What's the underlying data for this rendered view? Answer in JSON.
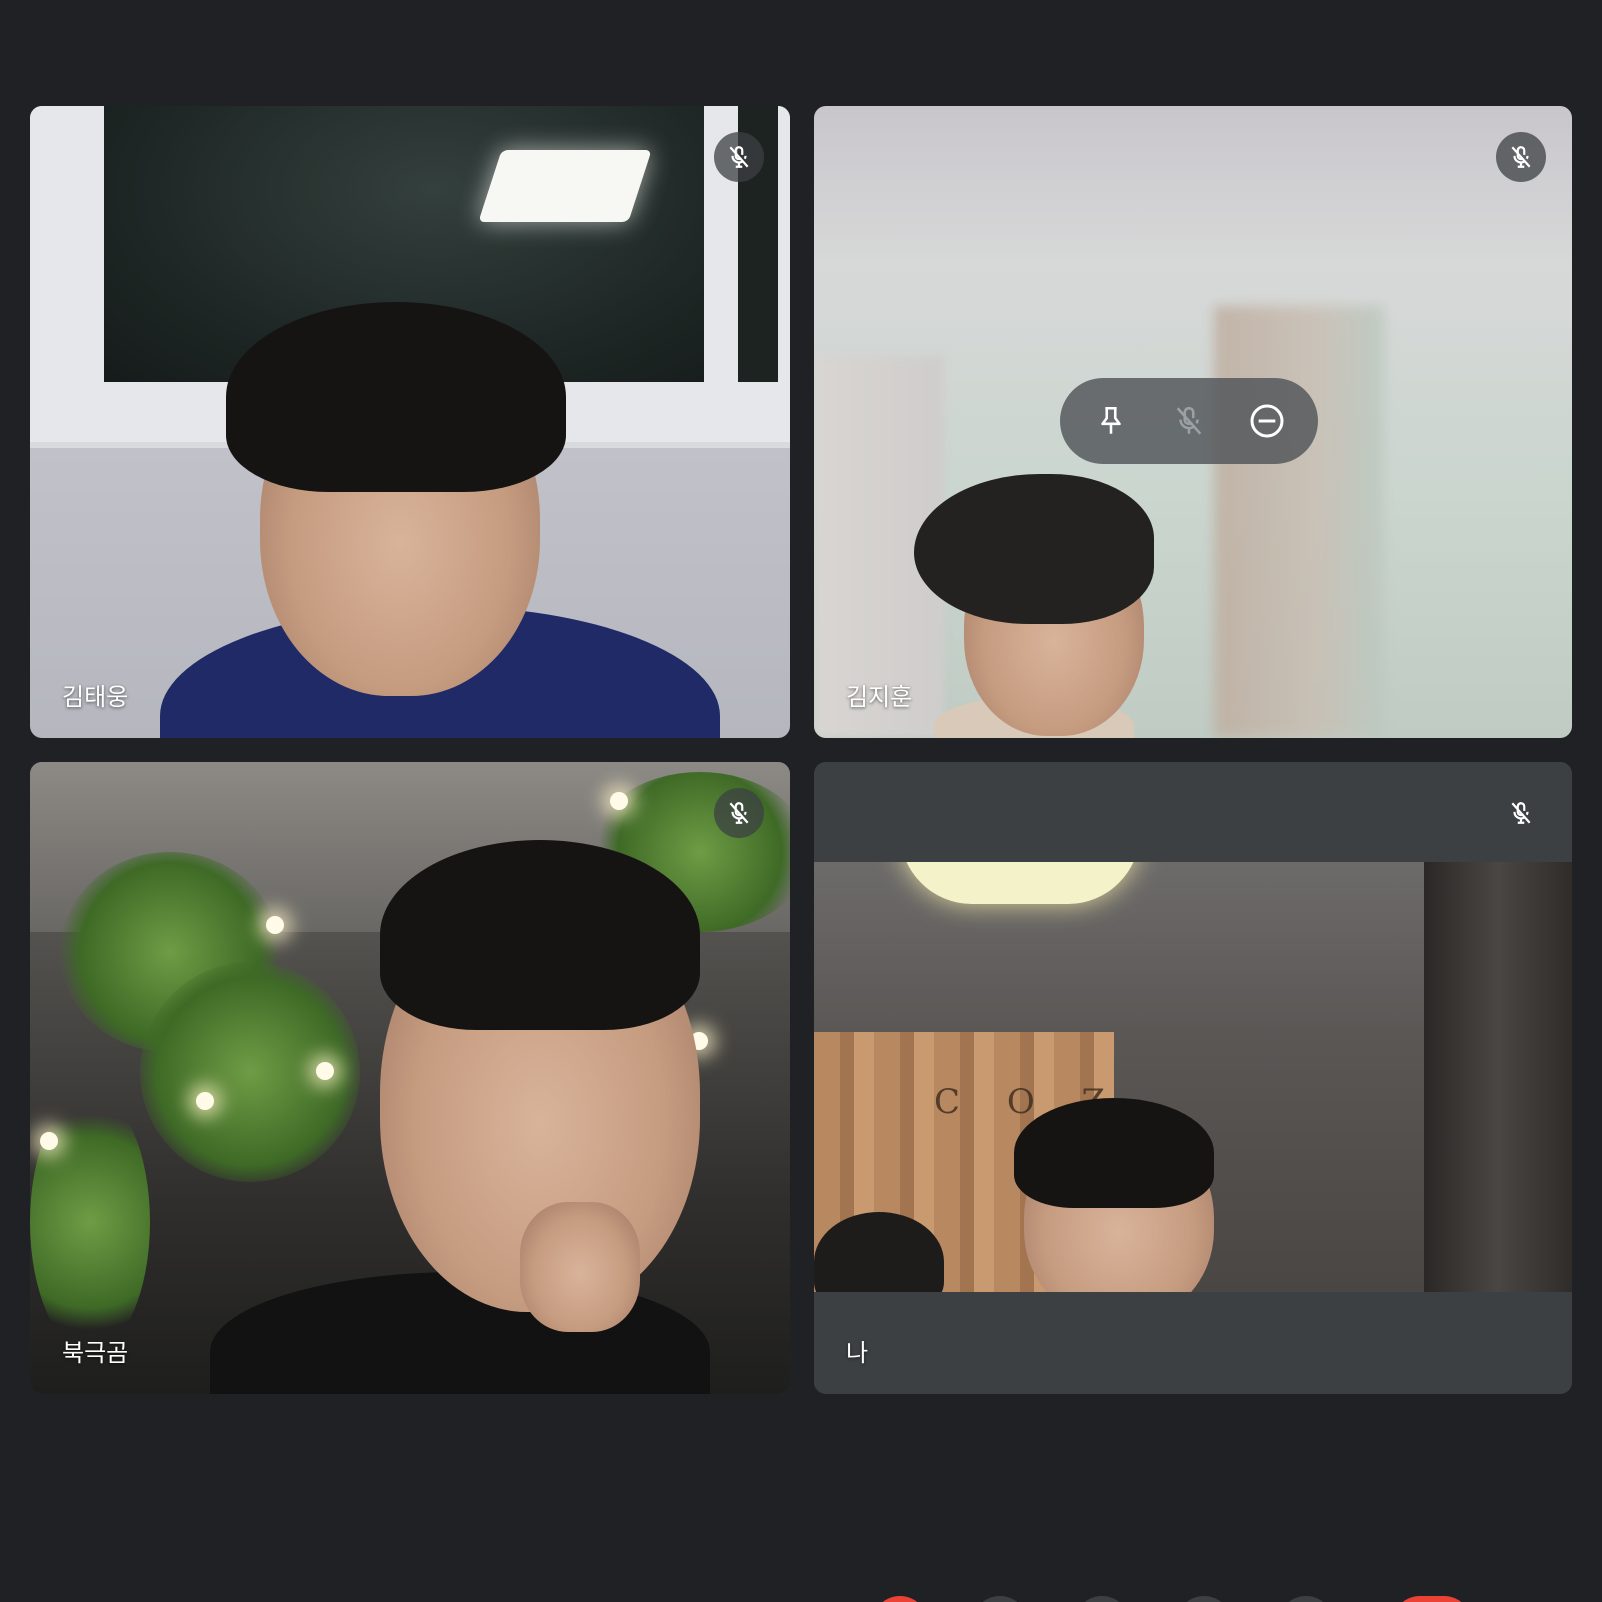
{
  "participants": [
    {
      "name": "김태웅",
      "muted": true
    },
    {
      "name": "김지훈",
      "muted": true
    },
    {
      "name": "북극곰",
      "muted": true
    },
    {
      "name": "나",
      "muted": true
    }
  ],
  "self_view": {
    "background_text": "C O Z"
  },
  "hover_controls": {
    "pin_icon": "pin-icon",
    "mute_icon": "mic-off-icon",
    "remove_icon": "minus-circle-icon"
  },
  "colors": {
    "background": "#202124",
    "tile": "#3c4043",
    "danger": "#ea4335"
  }
}
